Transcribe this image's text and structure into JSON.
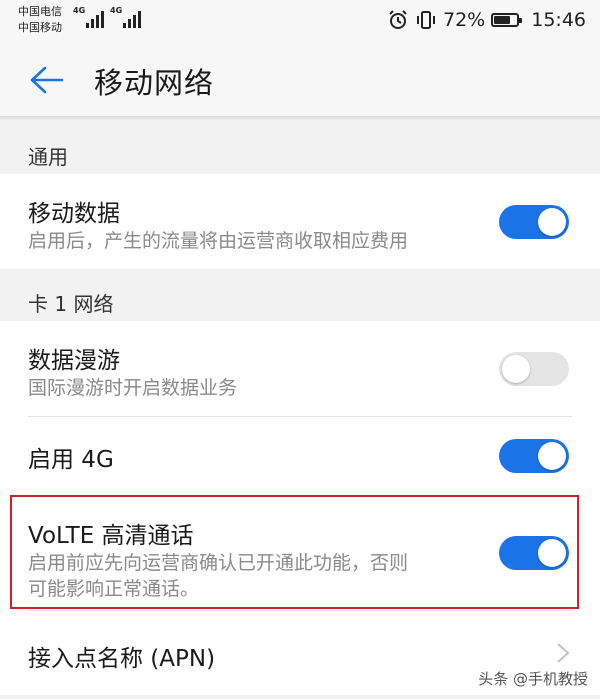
{
  "status_bar": {
    "carrier1": "中国电信",
    "carrier2": "中国移动",
    "network1": "4G",
    "network2": "4G",
    "battery_percent": "72%",
    "battery_level": 0.72,
    "time": "15:46",
    "icons": [
      "signal-icon",
      "alarm-icon",
      "vibrate-icon",
      "battery-icon"
    ]
  },
  "app_bar": {
    "back_icon": "back-arrow-icon",
    "title": "移动网络"
  },
  "sections": {
    "general": "通用",
    "card1": "卡 1 网络"
  },
  "settings": {
    "mobile_data": {
      "title": "移动数据",
      "subtitle": "启用后，产生的流量将由运营商收取相应费用",
      "enabled": true
    },
    "data_roaming": {
      "title": "数据漫游",
      "subtitle": "国际漫游时开启数据业务",
      "enabled": false
    },
    "enable_4g": {
      "title": "启用 4G",
      "enabled": true
    },
    "volte": {
      "title": "VoLTE 高清通话",
      "subtitle_line1": "启用前应先向运营商确认已开通此功能，否则",
      "subtitle_line2": "可能影响正常通话。",
      "enabled": true
    },
    "apn": {
      "title": "接入点名称 (APN)",
      "icon": "chevron-right-icon"
    }
  },
  "colors": {
    "accent": "#1b73e8",
    "highlight_border": "#d0222a",
    "toggle_off": "#e4e4e4"
  },
  "watermark": "头条 @手机教授"
}
